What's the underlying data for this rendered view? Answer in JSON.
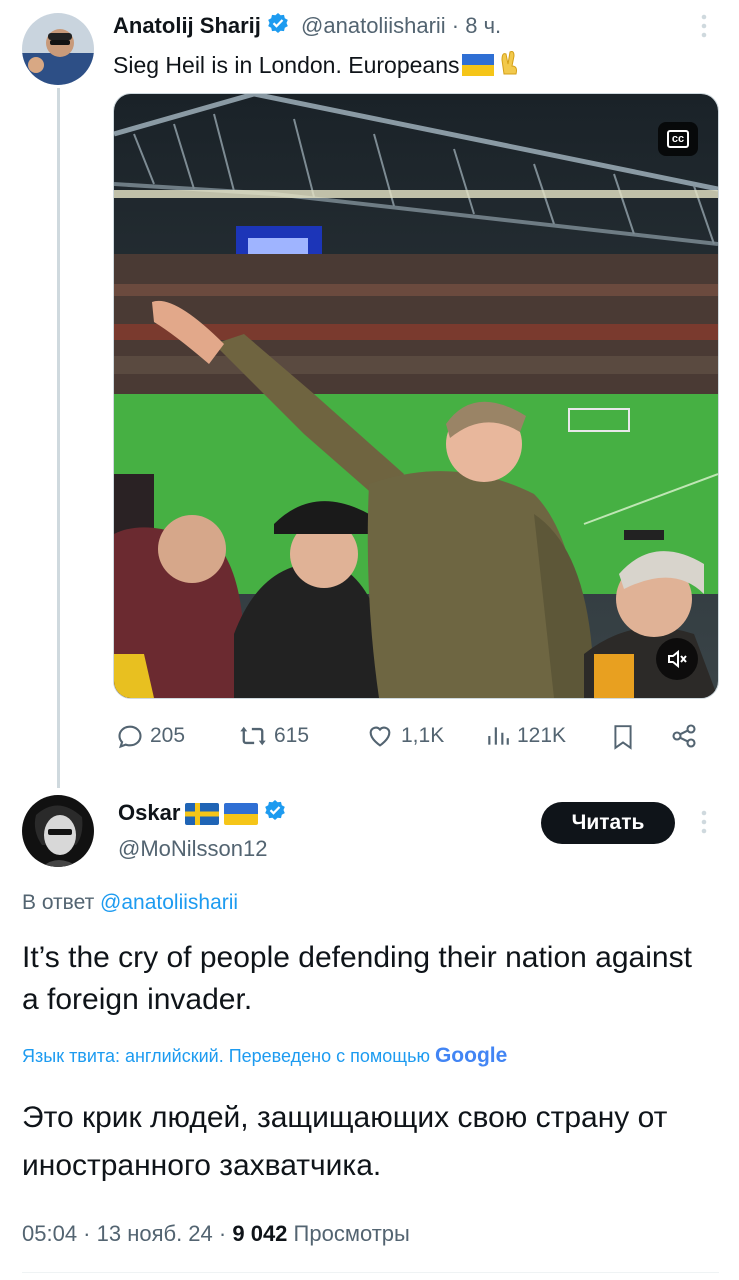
{
  "tweet1": {
    "display_name": "Anatolij Sharij",
    "handle": "@anatoliisharii",
    "separator": "·",
    "time": "8 ч.",
    "text": "Sieg Heil is in London. Europeans",
    "emoji_trail": "🇺🇦✌️",
    "media_badge": "cc",
    "stats": {
      "replies": "205",
      "reposts": "615",
      "likes": "1,1K",
      "views": "121K"
    }
  },
  "tweet2": {
    "display_name": "Oskar",
    "handle": "@MoNilsson12",
    "follow_label": "Читать",
    "reply_prefix": "В ответ",
    "reply_to": "@anatoliisharii",
    "text": "It’s the cry of people defending their nation against a foreign invader.",
    "translation_note": "Язык твита: английский. Переведено с помощью",
    "google_label": "Google",
    "translated_text": "Это крик людей, защищающих свою страну от иностранного захватчика.",
    "timestamp": "05:04 · 13 нояб. 24 ·",
    "views_count": "9 042",
    "views_label": "Просмотры"
  },
  "colors": {
    "text": "#0f1419",
    "muted": "#536471",
    "accent": "#1d9bf0",
    "border": "#cfd9de"
  },
  "icons": [
    "more-icon",
    "verified-icon",
    "cc-icon",
    "mute-icon",
    "reply-icon",
    "repost-icon",
    "like-icon",
    "views-icon",
    "bookmark-icon",
    "share-icon"
  ]
}
